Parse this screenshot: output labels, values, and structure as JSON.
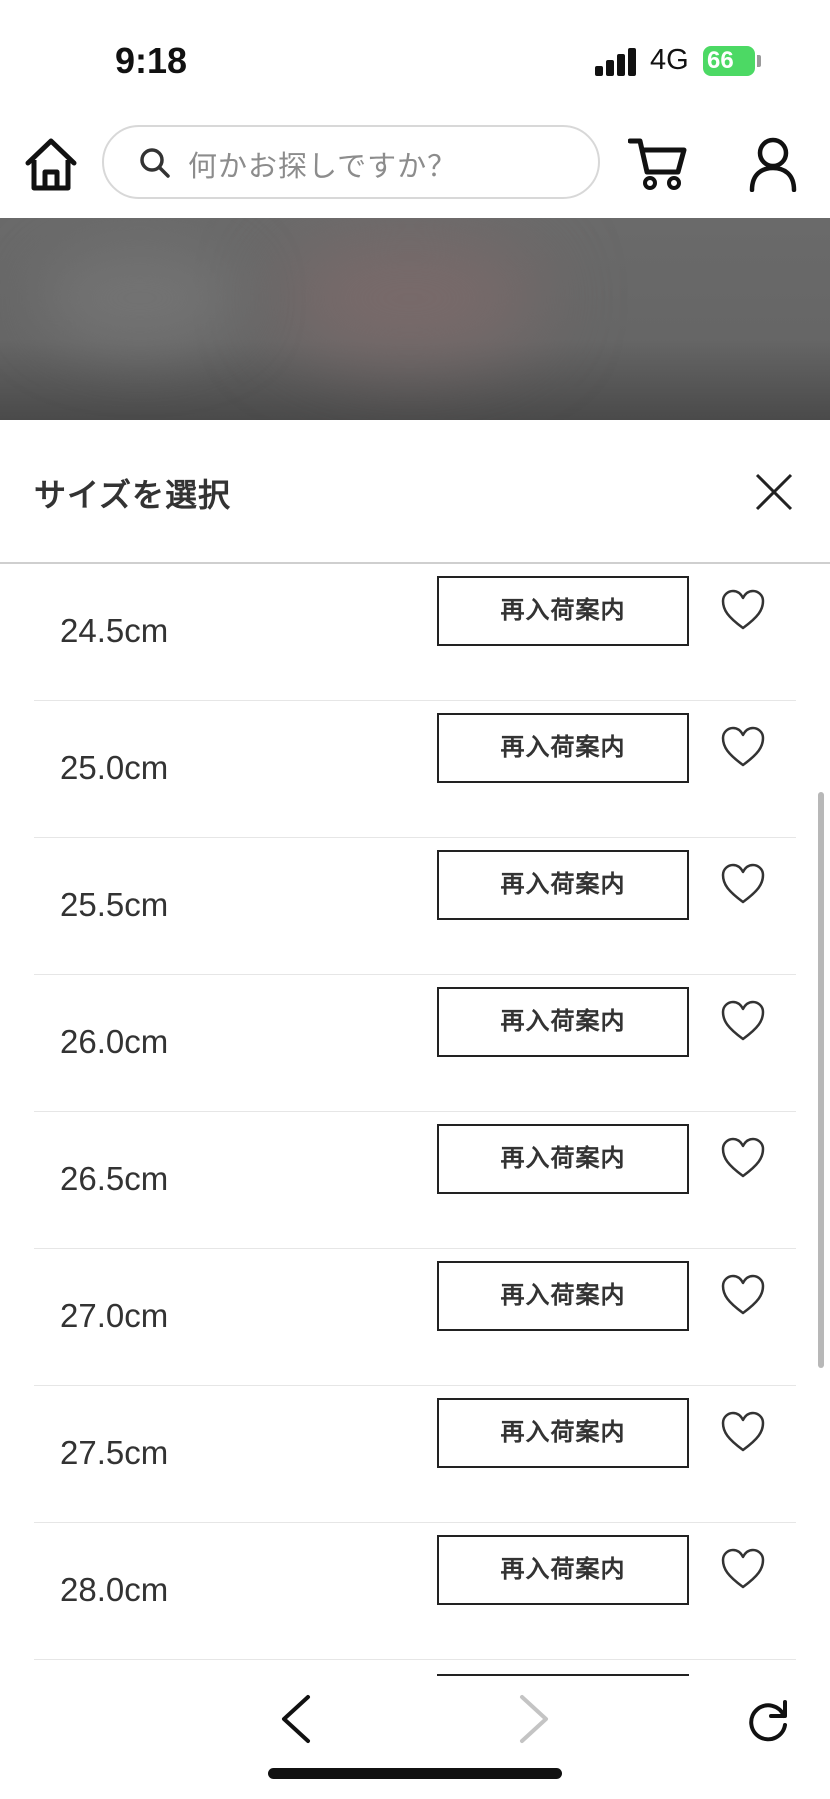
{
  "status_bar": {
    "time": "9:18",
    "network": "4G",
    "battery": "66"
  },
  "search": {
    "placeholder": "何かお探しですか？"
  },
  "sheet": {
    "title": "サイズを選択"
  },
  "sizes": [
    {
      "size": "24.5cm",
      "action": "再入荷案内"
    },
    {
      "size": "25.0cm",
      "action": "再入荷案内"
    },
    {
      "size": "25.5cm",
      "action": "再入荷案内"
    },
    {
      "size": "26.0cm",
      "action": "再入荷案内"
    },
    {
      "size": "26.5cm",
      "action": "再入荷案内"
    },
    {
      "size": "27.0cm",
      "action": "再入荷案内"
    },
    {
      "size": "27.5cm",
      "action": "再入荷案内"
    },
    {
      "size": "28.0cm",
      "action": "再入荷案内"
    }
  ],
  "icons": [
    "home-icon",
    "search-icon",
    "cart-icon",
    "user-icon",
    "close-icon",
    "heart-icon",
    "back-icon",
    "forward-icon",
    "reload-icon"
  ],
  "colors": {
    "battery": "#4cd964",
    "text": "#333333",
    "border": "#222222"
  }
}
